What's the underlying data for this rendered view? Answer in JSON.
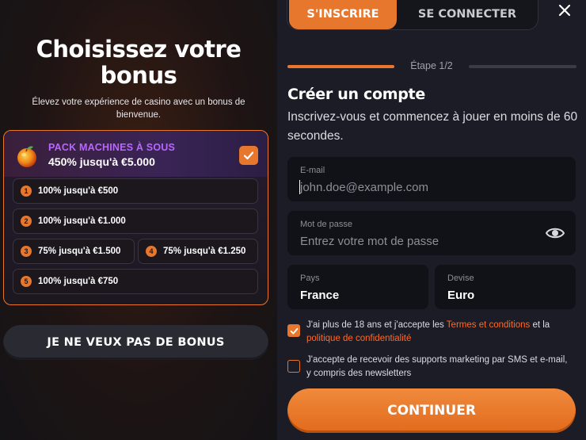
{
  "left": {
    "title": "Choisissez votre bonus",
    "subtitle": "Élevez votre expérience de casino avec un bonus de bienvenue.",
    "pack": {
      "icon": "peach-fruit-icon",
      "name": "PACK MACHINES À SOUS",
      "amount": "450% jusqu'à €5.000",
      "selected": true
    },
    "offers": [
      {
        "num": "1",
        "label": "100% jusqu'à €500"
      },
      {
        "num": "2",
        "label": "100% jusqu'à €1.000"
      },
      {
        "num": "3",
        "label": "75% jusqu'à €1.500"
      },
      {
        "num": "4",
        "label": "75% jusqu'à €1.250"
      },
      {
        "num": "5",
        "label": "100% jusqu'à €750"
      }
    ],
    "no_bonus_label": "JE NE VEUX PAS DE BONUS"
  },
  "right": {
    "tabs": {
      "signup": "S'INSCRIRE",
      "login": "SE CONNECTER",
      "active": "signup"
    },
    "step_label": "Étape 1/2",
    "step_progress": 0.5,
    "heading": "Créer un compte",
    "subheading": "Inscrivez-vous et commencez à jouer en moins de 60 secondes.",
    "email": {
      "label": "E-mail",
      "placeholder": "john.doe@example.com",
      "value": ""
    },
    "password": {
      "label": "Mot de passe",
      "placeholder": "Entrez votre mot de passe",
      "value": ""
    },
    "country": {
      "label": "Pays",
      "value": "France"
    },
    "currency": {
      "label": "Devise",
      "value": "Euro"
    },
    "consent_age": {
      "checked": true,
      "text_before": "J'ai plus de 18 ans et j'accepte les ",
      "link_terms": "Termes et conditions",
      "text_mid": " et la ",
      "link_privacy": "politique de confidentialité"
    },
    "consent_marketing": {
      "checked": false,
      "text": "J'accepte de recevoir des supports marketing par SMS et e-mail, y compris des newsletters"
    },
    "continue_label": "CONTINUER"
  },
  "colors": {
    "accent": "#e8772e",
    "pack_name": "#b866ff",
    "link": "#ff6a2a",
    "panel_bg": "#1b1c25",
    "field_bg": "#111217"
  }
}
